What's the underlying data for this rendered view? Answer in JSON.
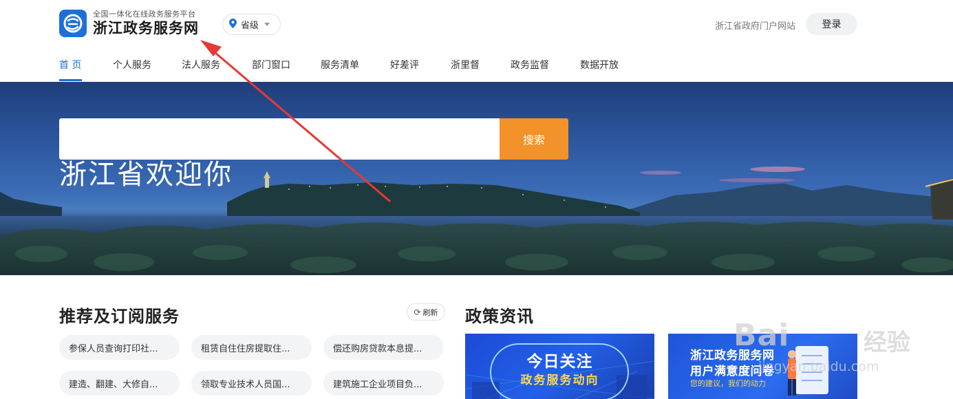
{
  "header": {
    "logo_subtitle": "全国一体化在线政务服务平台",
    "logo_title": "浙江政务服务网",
    "region": "省级",
    "portal_link": "浙江省政府门户网站",
    "login": "登录"
  },
  "nav": {
    "items": [
      {
        "label": "首 页",
        "active": true
      },
      {
        "label": "个人服务"
      },
      {
        "label": "法人服务"
      },
      {
        "label": "部门窗口"
      },
      {
        "label": "服务清单"
      },
      {
        "label": "好差评"
      },
      {
        "label": "浙里督"
      },
      {
        "label": "政务监督"
      },
      {
        "label": "数据开放"
      }
    ]
  },
  "banner": {
    "welcome": "浙江省欢迎你",
    "search_placeholder": "",
    "search_button": "搜索"
  },
  "recommend": {
    "title": "推荐及订阅服务",
    "refresh": "刷新",
    "items": [
      "参保人员查询打印社...",
      "租赁自住住房提取住...",
      "偿还购房贷款本息提...",
      "建造、翻建、大修自...",
      "领取专业技术人员国...",
      "建筑施工企业项目负..."
    ]
  },
  "news": {
    "title": "政策资讯",
    "card1": {
      "line1": "今日关注",
      "line2": "政务服务动向"
    },
    "card2": {
      "line1": "浙江政务服务网",
      "line2": "用户满意度问卷",
      "line3": "您的建议，我们的动力"
    }
  },
  "watermark": {
    "main": "Bai",
    "brand": "经验",
    "url": "jingyan.baidu.com"
  },
  "colors": {
    "primary": "#1b6fd6",
    "search_button": "#f39229",
    "annotation_arrow": "#e53935"
  }
}
